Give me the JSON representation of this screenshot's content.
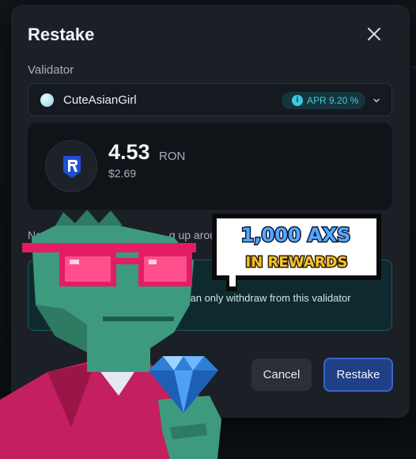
{
  "modal": {
    "title": "Restake",
    "validator_label": "Validator",
    "validator": {
      "name": "CuteAsianGirl",
      "apr": "APR 9.20 %"
    },
    "amount": {
      "value": "4.53",
      "unit": "RON",
      "usd": "$2.69"
    },
    "next_reward_text": "Next",
    "next_reward_text_tail": "g up arou",
    "notice_text": "can only withdraw from this validator",
    "cancel_label": "Cancel",
    "restake_label": "Restake"
  },
  "promo": {
    "line1": "1,000 AXS",
    "line2": "IN REWARDS"
  },
  "colors": {
    "accent": "#3cc9e3",
    "primary_button": "#1f3f86",
    "modal_bg": "#1b1f26"
  },
  "icons": {
    "close": "close-icon",
    "info": "info-icon",
    "chevron": "chevron-down-icon",
    "token": "ronin-token-icon",
    "avatar": "validator-avatar-icon",
    "mascot": "pixel-lizard-mascot",
    "diamond": "diamond-icon"
  }
}
